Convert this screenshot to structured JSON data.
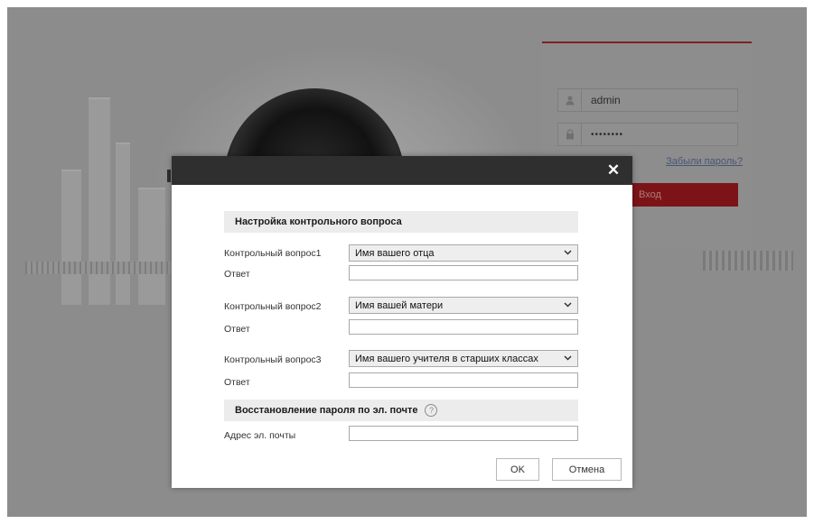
{
  "login": {
    "username": "admin",
    "password_mask": "••••••••",
    "forgot_label": "Забыли пароль?",
    "login_label": "Вход",
    "user_icon": "user-icon",
    "lock_icon": "lock-icon"
  },
  "dialog": {
    "close_glyph": "✕",
    "section_security": "Настройка контрольного вопроса",
    "questions": [
      {
        "label": "Контрольный вопрос1",
        "selected": "Имя вашего отца",
        "answer_label": "Ответ",
        "answer_value": ""
      },
      {
        "label": "Контрольный вопрос2",
        "selected": "Имя вашей матери",
        "answer_label": "Ответ",
        "answer_value": ""
      },
      {
        "label": "Контрольный вопрос3",
        "selected": "Имя вашего учителя в старших классах",
        "answer_label": "Ответ",
        "answer_value": ""
      }
    ],
    "section_email": "Восстановление пароля по эл. почте",
    "help_glyph": "?",
    "email_label": "Адрес эл. почты",
    "email_value": "",
    "ok_label": "OK",
    "cancel_label": "Отмена"
  },
  "colors": {
    "header_bg": "#2f2f2f",
    "section_bg": "#ececec",
    "login_accent": "#7c1417"
  }
}
